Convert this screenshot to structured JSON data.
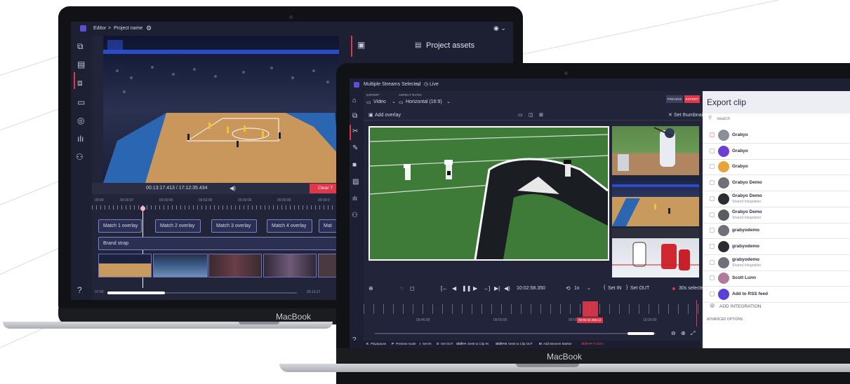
{
  "back_laptop": {
    "breadcrumb_root": "Editor",
    "breadcrumb_sep": ">",
    "project_name": "Project name",
    "timecode": "00:13:17.413 / 17:12:35.434",
    "clear_button": "Clear T",
    "assets_title": "Project assets",
    "ruler_ticks": [
      "00:00",
      "00:00:07",
      "00:00:00",
      "00:52:00",
      "00:00:00",
      "00:00:00",
      "00:00:0"
    ],
    "overlays": [
      "Match 1 overlay",
      "Match 2 overlay",
      "Match 3 overlay",
      "Match 4 overlay",
      "Mat"
    ],
    "brand_strap": "Brand strap",
    "scroll_start": "07:00",
    "scroll_end": "05:13:17",
    "brand": "MacBook"
  },
  "front_laptop": {
    "stream_selector": "Multiple Streams Selected",
    "live_label": "Live",
    "export_label": "EXPORT",
    "export_value": "Video",
    "aspect_label": "ASPECT RATIO",
    "aspect_value": "Horizontal (16:9)",
    "preview_button": "PREVIEW",
    "export_button": "EXPORT",
    "add_overlay": "Add overlay",
    "set_thumbnail": "Set thumbnail",
    "time_display": "10:02:58.350",
    "speed": "1x",
    "set_in": "Set IN",
    "set_out": "Set OUT",
    "selected_badge": "30s selected",
    "ruler_ticks": [
      "09:45:00",
      "09:50:00",
      "09:55:00",
      "10:00:00"
    ],
    "playhead_time": "09:55:42.456:12",
    "shortcuts": [
      {
        "key": "K",
        "label": "Play/pause"
      },
      {
        "key": "P",
        "label": "Preview mode"
      },
      {
        "key": "I",
        "label": "Set IN"
      },
      {
        "key": "O",
        "label": "Set OUT"
      },
      {
        "key": "Shift+I",
        "label": "Seek to Clip IN"
      },
      {
        "key": "Shift+O",
        "label": "Seek to Clip OUT"
      },
      {
        "key": "M",
        "label": "Add Moment Marker"
      },
      {
        "key": "Shift+P",
        "label": "Publish"
      }
    ],
    "brand": "MacBook"
  },
  "export_panel": {
    "title": "Export clip",
    "search_placeholder": "Search",
    "items": [
      {
        "name": "Grabyo",
        "sub": "",
        "color": "#8d8f98"
      },
      {
        "name": "Grabyo",
        "sub": "",
        "color": "#6b3fd1"
      },
      {
        "name": "Grabyo",
        "sub": "",
        "color": "#e8a33a"
      },
      {
        "name": "Grabyo Demo",
        "sub": "",
        "color": "#6f7178"
      },
      {
        "name": "Grabyo Demo",
        "sub": "Shared Integration",
        "color": "#2c2d33"
      },
      {
        "name": "Grabyo Demo",
        "sub": "Shared Integration",
        "color": "#5a5c63"
      },
      {
        "name": "grabyodemo",
        "sub": "",
        "color": "#6f7178"
      },
      {
        "name": "grabyodemo",
        "sub": "",
        "color": "#2c2d33"
      },
      {
        "name": "grabyodemo",
        "sub": "Shared Integration",
        "color": "#6f7178"
      },
      {
        "name": "Scott Lunn",
        "sub": "",
        "color": "#b07a9a"
      },
      {
        "name": "Add to RSS feed",
        "sub": "",
        "color": "#5b3fd8"
      }
    ],
    "add_integration": "ADD INTEGRATION",
    "advanced_options": "ADVANCED OPTIONS"
  },
  "colors": {
    "accent_red": "#e0384a",
    "panel_bg": "#22253a",
    "clip_border": "#7e83c9",
    "export_panel_bg": "#ffffff"
  }
}
